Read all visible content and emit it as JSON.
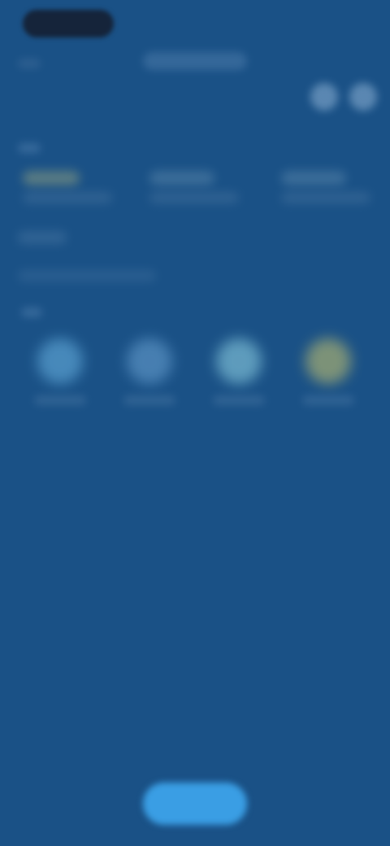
{
  "colors": {
    "background": "#1a5186",
    "cta": "#3a9ee4",
    "status_pill": "#15243a",
    "tile_1": "#4f93c4",
    "tile_2": "#4f87b9",
    "tile_3": "#6aa9c6",
    "tile_4": "#8e9e76"
  },
  "icons": [
    "back-icon",
    "menu-icon",
    "more-icon",
    "weather-icon"
  ]
}
